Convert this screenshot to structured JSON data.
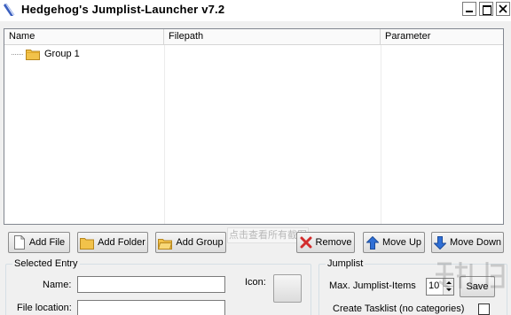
{
  "window": {
    "title": "Hedgehog's Jumplist-Launcher v7.2",
    "controls": [
      "minimize",
      "maximize",
      "close"
    ]
  },
  "list": {
    "columns": [
      "Name",
      "Filepath",
      "Parameter"
    ],
    "rows": [
      {
        "name": "Group 1",
        "icon": "folder-icon",
        "filepath": "",
        "parameter": ""
      }
    ]
  },
  "toolbar": {
    "add_file": "Add File",
    "add_folder": "Add Folder",
    "add_group": "Add Group",
    "remove": "Remove",
    "move_up": "Move Up",
    "move_down": "Move Down"
  },
  "tooltip": "点击查看所有截图",
  "selected_entry": {
    "title": "Selected Entry",
    "name_label": "Name:",
    "name_value": "",
    "file_location_label": "File location:",
    "file_location_value": "",
    "icon_label": "Icon:"
  },
  "jumplist": {
    "title": "Jumplist",
    "max_items_label": "Max. Jumplist-Items",
    "max_items_value": "10",
    "save_label": "Save",
    "create_tasklist_label": "Create Tasklist (no categories)",
    "create_tasklist_checked": false
  },
  "colors": {
    "window_bg": "#f0f0f0",
    "list_bg": "#ffffff",
    "folder": "#f2c24a",
    "arrow_blue": "#2f6fd6",
    "remove_red": "#d22d2d"
  }
}
